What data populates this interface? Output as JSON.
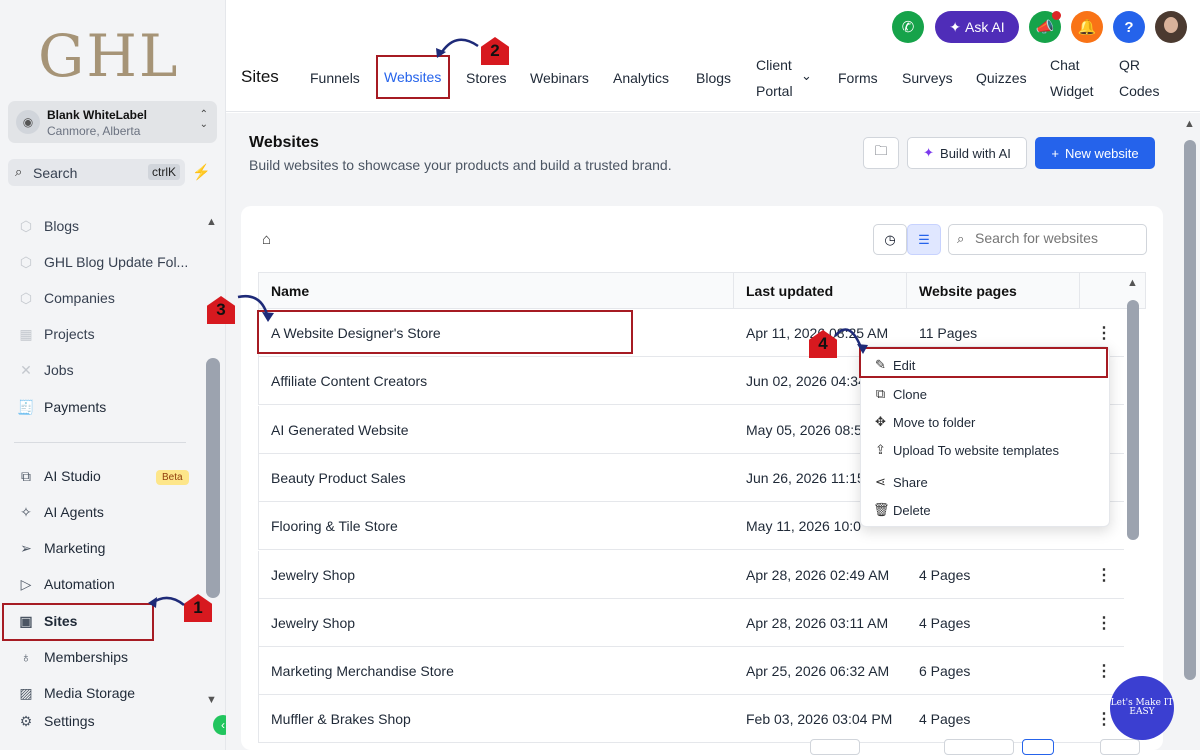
{
  "sidebar": {
    "logo": "GHL",
    "account": {
      "name": "Blank WhiteLabel",
      "location": "Canmore, Alberta"
    },
    "search": {
      "label": "Search",
      "shortcut": "ctrlK"
    },
    "items": [
      {
        "label": "Blogs",
        "icon": "box-icon"
      },
      {
        "label": "GHL Blog Update Fol...",
        "icon": "box-icon"
      },
      {
        "label": "Companies",
        "icon": "box-icon"
      },
      {
        "label": "Projects",
        "icon": "grid-icon"
      },
      {
        "label": "Jobs",
        "icon": "tools-icon"
      },
      {
        "label": "Payments",
        "icon": "receipt-icon"
      },
      {
        "label": "AI Studio",
        "icon": "ai-studio-icon",
        "badge": "Beta"
      },
      {
        "label": "AI Agents",
        "icon": "sparkle-icon"
      },
      {
        "label": "Marketing",
        "icon": "send-icon"
      },
      {
        "label": "Automation",
        "icon": "automation-icon"
      },
      {
        "label": "Sites",
        "icon": "sites-icon"
      },
      {
        "label": "Memberships",
        "icon": "award-icon"
      },
      {
        "label": "Media Storage",
        "icon": "image-icon"
      },
      {
        "label": "Settings",
        "icon": "gear-icon"
      }
    ]
  },
  "topnav": {
    "title": "Sites",
    "tabs": [
      {
        "label": "Funnels"
      },
      {
        "label": "Websites",
        "active": true
      },
      {
        "label": "Stores"
      },
      {
        "label": "Webinars"
      },
      {
        "label": "Analytics"
      },
      {
        "label": "Blogs"
      },
      {
        "label": "Client Portal"
      },
      {
        "label": "Forms"
      },
      {
        "label": "Surveys"
      },
      {
        "label": "Quizzes"
      },
      {
        "label": "Chat Widget"
      },
      {
        "label": "QR Codes"
      }
    ],
    "client_portal_l1": "Client",
    "client_portal_l2": "Portal",
    "chat_widget_l1": "Chat",
    "chat_widget_l2": "Widget",
    "qr_codes_l1": "QR",
    "qr_codes_l2": "Codes",
    "ask_ai": "Ask AI",
    "help": "?"
  },
  "page": {
    "title": "Websites",
    "subtitle": "Build websites to showcase your products and build a trusted brand.",
    "build_ai": "Build with AI",
    "new_website": "New website",
    "search_placeholder": "Search for websites"
  },
  "table": {
    "columns": [
      "Name",
      "Last updated",
      "Website pages"
    ],
    "rows": [
      {
        "name": "A Website Designer's Store",
        "updated": "Apr 11, 2026 08:25 AM",
        "pages": "11 Pages"
      },
      {
        "name": "Affiliate Content Creators",
        "updated": "Jun 02, 2026 04:34",
        "pages": ""
      },
      {
        "name": "AI Generated Website",
        "updated": "May 05, 2026 08:5",
        "pages": ""
      },
      {
        "name": "Beauty Product Sales",
        "updated": "Jun 26, 2026 11:15",
        "pages": ""
      },
      {
        "name": "Flooring & Tile Store",
        "updated": "May 11, 2026 10:0",
        "pages": ""
      },
      {
        "name": "Jewelry Shop",
        "updated": "Apr 28, 2026 02:49 AM",
        "pages": "4 Pages"
      },
      {
        "name": "Jewelry Shop",
        "updated": "Apr 28, 2026 03:11 AM",
        "pages": "4 Pages"
      },
      {
        "name": "Marketing Merchandise Store",
        "updated": "Apr 25, 2026 06:32 AM",
        "pages": "6 Pages"
      },
      {
        "name": "Muffler & Brakes Shop",
        "updated": "Feb 03, 2026 03:04 PM",
        "pages": "4 Pages"
      }
    ]
  },
  "context_menu": {
    "items": [
      {
        "label": "Edit",
        "icon": "pencil-icon"
      },
      {
        "label": "Clone",
        "icon": "copy-icon"
      },
      {
        "label": "Move to folder",
        "icon": "move-icon"
      },
      {
        "label": "Upload To website templates",
        "icon": "upload-icon"
      },
      {
        "label": "Share",
        "icon": "share-icon"
      },
      {
        "label": "Delete",
        "icon": "trash-icon"
      }
    ]
  },
  "annotations": {
    "steps": [
      "1",
      "2",
      "3",
      "4"
    ],
    "color": "#a61b23"
  },
  "watermark": "Let's Make IT EASY",
  "colors": {
    "accent": "#2563eb",
    "ask_ai_bg": "#4f2db8",
    "phone_green": "#16a34a",
    "notification_orange": "#f97316",
    "help_blue": "#2563eb",
    "highlight_red": "#a61b23"
  }
}
